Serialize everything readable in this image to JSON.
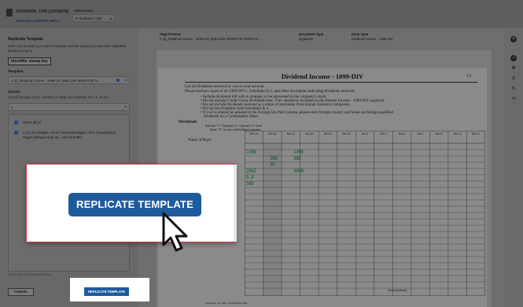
{
  "header": {
    "client_name": "TAXPAYER, TOM (1234567B)",
    "engagement_link": "VIEW ENGAGEMENT INFO",
    "view_pages_label": "VIEW PAGES",
    "view_pages_value": "In Verification (54)"
  },
  "left_panel": {
    "title": "Replicate Template",
    "description": "Select the template you want to replicate and the page(s) you want the replicated template to go to.",
    "stamp_button": "Identifier stamp key",
    "template_label": "Template:",
    "template_value": "3 (3)_Dividend Income - 1099-DIV (MELLON INVESTOR S...",
    "search_label": "Search",
    "search_hint": "Search for page name, number, or range (for example, K-1, 4, 11-15)",
    "search_value": "1",
    "select_all_label": "Select all (1)",
    "list_item": "1 (1)_W-2 Wages / W-2C Corrected Wages / W-3 Transmittal of Wages (Whynot Stop Inc., 123-45-6789)",
    "shift_hint": "Shift + Click for Range Selection",
    "cancel_button": "CANCEL",
    "replicate_button": "REPLICATE TEMPLATE"
  },
  "preview_header": {
    "page_preview_label": "Page Preview",
    "page_preview_value": "3 (3)_Dividend Income - 1099-DIV (MELLON INVESTOR SERVICE...",
    "document_type_label": "Document Type",
    "document_type_value": "Organizer",
    "form_type_label": "Form Type",
    "form_type_value": "Dividend Income - 1099-DIV"
  },
  "document": {
    "title": "Dividend Income - 1099-DIV",
    "page_number": "13",
    "intro1": "List all dividends received by you or your account.",
    "intro2": "Please enclose copies of all 1099-DIV's, Schedules K-1, and other documents indicating dividends received.",
    "bullets": [
      "Include dividends left with a company to be reinvested in the company's stock.",
      "Do not include Credit Union Dividends here. They should be included on the Interest Income - 1099-INT organizer.",
      "Do not include dividends received as a return of premiums from mutual insurance companies.",
      "Do not list dividends from Schedules K-1.",
      "If you've entered an amount in the Foreign Tax Paid column, please enter foreign country and break out foreign qualified",
      "dividends on a Continuation Sheet."
    ],
    "dividends_heading": "Dividends",
    "indicate_line": "Indicate: T = Taxpayer, S = Spouse, J = Joint",
    "enter_x_line": "Enter \"X\" if state withholding is present",
    "name_of_payer": "Name of Payer",
    "box_headers": [
      "Box 1a",
      "Box 1b",
      "Box 2a",
      "Box 2b",
      "Box 2c",
      "Box 2d",
      "Box 3",
      "Box 4",
      "Box 6",
      "Box 7",
      "Box 9",
      "Box 10",
      "Box 11"
    ],
    "total_label": "Total dividends",
    "footer": "Organizer | Income | Dividend Income",
    "handwritten": [
      "1308",
      "388",
      "20",
      "388",
      "1308",
      "2562",
      "3608",
      "5.8",
      "588"
    ]
  },
  "right_bar_icons": [
    "plus-icon",
    "minus-icon",
    "move-icon",
    "rotate-left-icon",
    "rotate-right-icon",
    "undo-icon"
  ]
}
